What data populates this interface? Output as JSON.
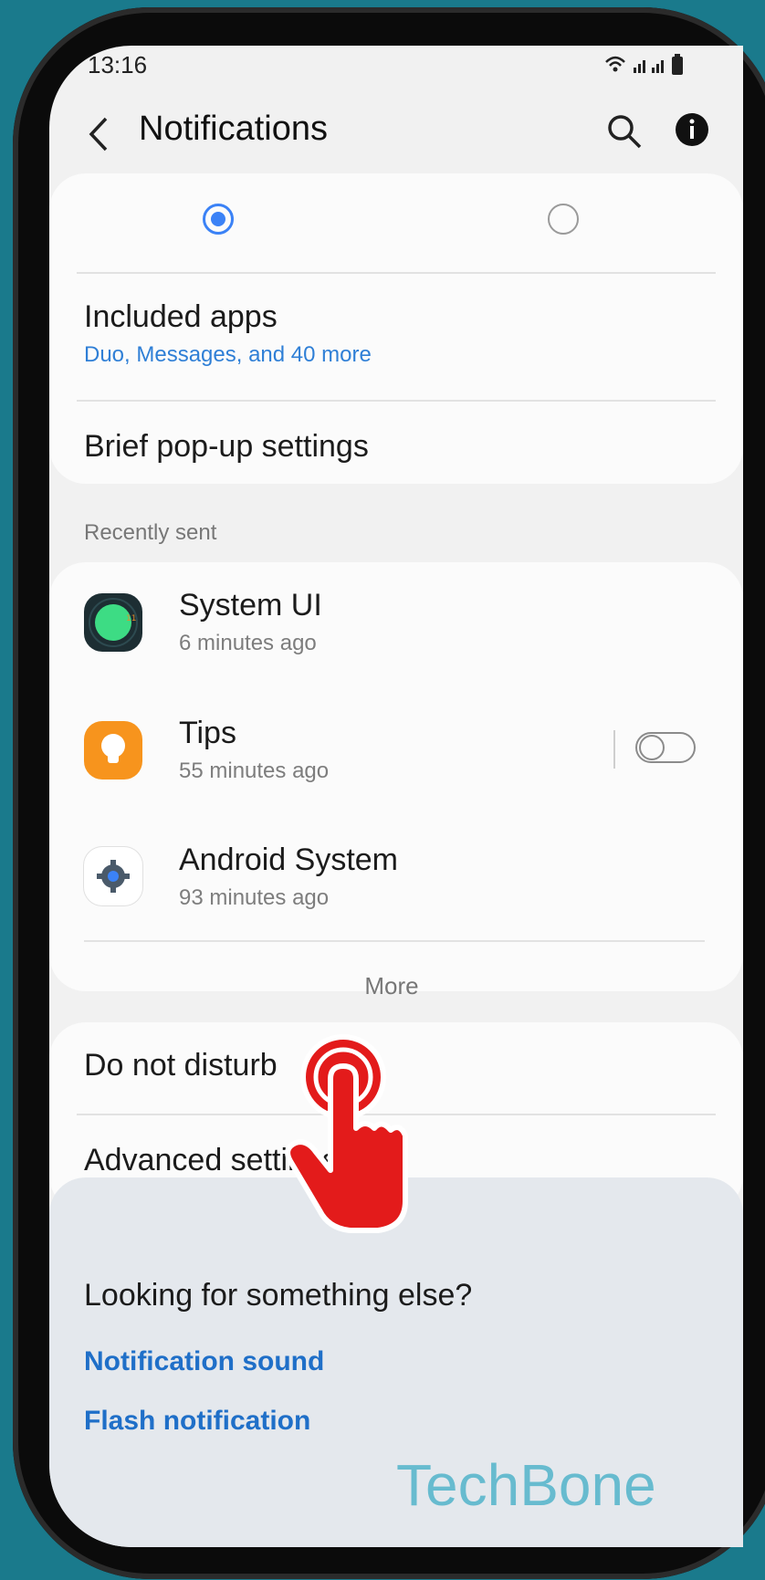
{
  "status_bar": {
    "time": "13:16",
    "icons": "wifi signal signal battery"
  },
  "header": {
    "title": "Notifications"
  },
  "settings_card": {
    "included_apps": {
      "label": "Included apps",
      "summary": "Duo, Messages, and 40 more"
    },
    "brief_popup": {
      "label": "Brief pop-up settings"
    }
  },
  "recent": {
    "section_label": "Recently sent",
    "items": [
      {
        "name": "System UI",
        "time": "6 minutes ago"
      },
      {
        "name": "Tips",
        "time": "55 minutes ago"
      },
      {
        "name": "Android System",
        "time": "93 minutes ago"
      }
    ],
    "more_label": "More"
  },
  "bottom_card": {
    "dnd": "Do not disturb",
    "advanced": "Advanced settings"
  },
  "suggest": {
    "heading": "Looking for something else?",
    "links": [
      "Notification sound",
      "Flash notification"
    ]
  },
  "watermark": "TechBone",
  "colors": {
    "accent": "#2f7fd6",
    "radio": "#3b82f6"
  }
}
